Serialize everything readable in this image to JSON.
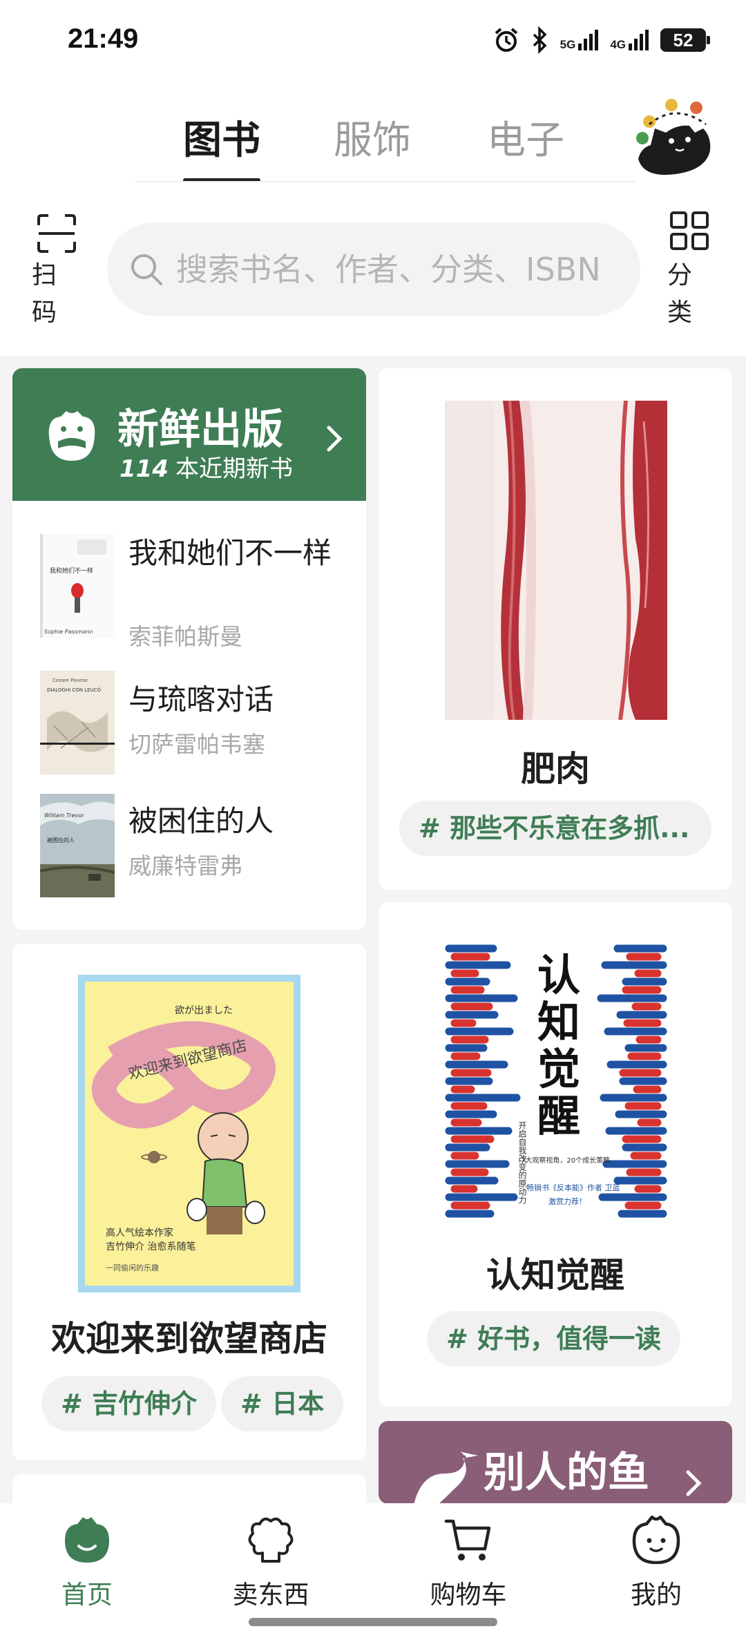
{
  "status_bar": {
    "time": "21:49",
    "battery": "52",
    "net1": "5G",
    "net2": "4G"
  },
  "tabs": [
    {
      "label": "图书",
      "active": true
    },
    {
      "label": "服饰",
      "active": false
    },
    {
      "label": "电子",
      "active": false
    }
  ],
  "toolbar": {
    "scan_label": "扫码",
    "category_label": "分类",
    "search_placeholder": "搜索书名、作者、分类、ISBN"
  },
  "fresh": {
    "title": "新鲜出版",
    "count": "114",
    "subtitle": "本近期新书",
    "books": [
      {
        "title": "我和她们不一样",
        "author": "索菲帕斯曼"
      },
      {
        "title": "与琉喀对话",
        "author": "切萨雷帕韦塞"
      },
      {
        "title": "被困住的人",
        "author": "威廉特雷弗"
      }
    ]
  },
  "feed": {
    "fatmeat": {
      "title": "肥肉",
      "tag": "# 那些不乐意在多抓..."
    },
    "cognition": {
      "title": "认知觉醒",
      "tag": "# 好书，值得一读"
    },
    "desire_store": {
      "title": "欢迎来到欲望商店",
      "tags": [
        "# 吉竹伸介",
        "# 日本"
      ]
    },
    "fish": {
      "title": "别人的鱼"
    }
  },
  "bottom_nav": [
    {
      "label": "首页",
      "icon": "home-icon",
      "active": true
    },
    {
      "label": "卖东西",
      "icon": "sell-icon",
      "active": false
    },
    {
      "label": "购物车",
      "icon": "cart-icon",
      "active": false
    },
    {
      "label": "我的",
      "icon": "profile-icon",
      "active": false
    }
  ],
  "colors": {
    "brand_green": "#3f7d55",
    "fish_purple": "#8a5e77"
  }
}
